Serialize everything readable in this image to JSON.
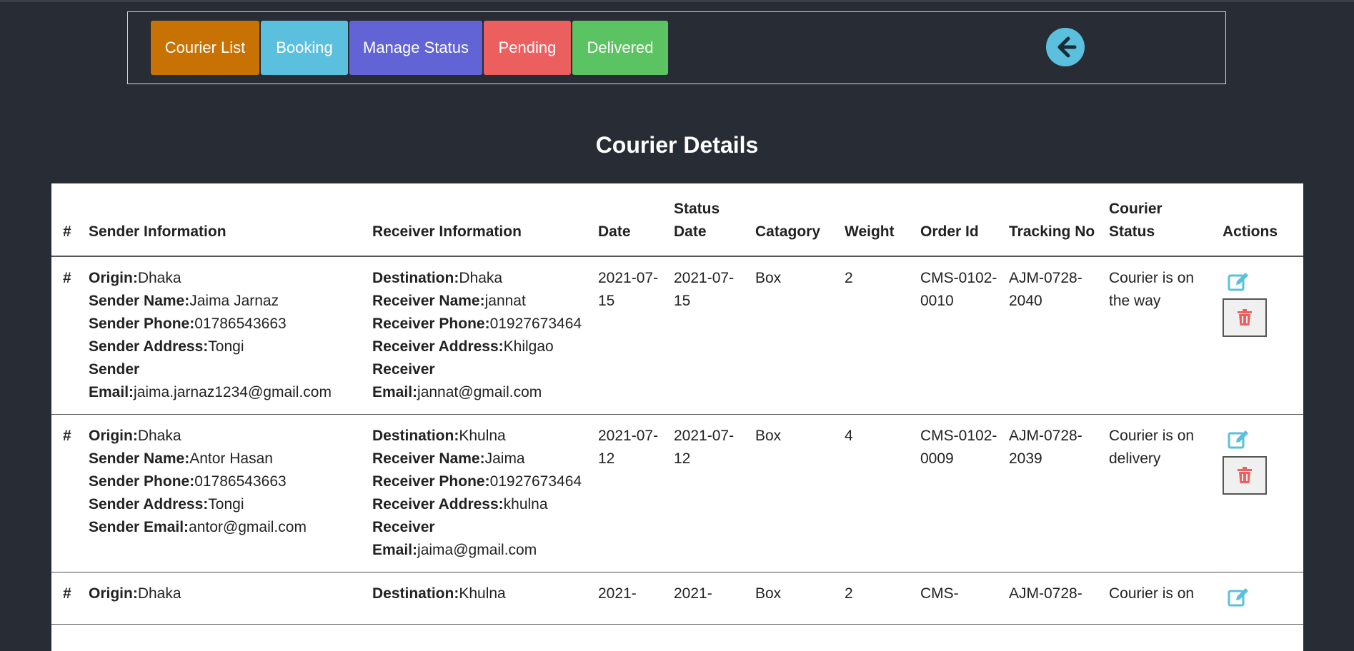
{
  "nav": {
    "buttons": [
      {
        "label": "Courier List",
        "color": "#c87203"
      },
      {
        "label": "Booking",
        "color": "#5bc0de"
      },
      {
        "label": "Manage Status",
        "color": "#6264d6"
      },
      {
        "label": "Pending",
        "color": "#ec5f5f"
      },
      {
        "label": "Delivered",
        "color": "#5cc362"
      }
    ],
    "back_icon": "arrow-left-circle-icon"
  },
  "title": "Courier Details",
  "table": {
    "headers": {
      "num": "#",
      "sender": "Sender Information",
      "receiver": "Receiver Information",
      "date": "Date",
      "status_date": "Status Date",
      "category": "Catagory",
      "weight": "Weight",
      "order_id": "Order Id",
      "tracking": "Tracking No",
      "courier_status": "Courier Status",
      "actions": "Actions"
    },
    "labels": {
      "origin": "Origin:",
      "sender_name": "Sender Name:",
      "sender_phone": "Sender Phone:",
      "sender_address": "Sender Address:",
      "sender_email": "Sender Email:",
      "destination": "Destination:",
      "receiver_name": "Receiver Name:",
      "receiver_phone": "Receiver Phone:",
      "receiver_address": "Receiver Address:",
      "receiver_email": "Receiver Email:"
    },
    "rows": [
      {
        "num": "#",
        "origin": "Dhaka",
        "sender_name": "Jaima Jarnaz",
        "sender_phone": "01786543663",
        "sender_address": "Tongi",
        "sender_email": "jaima.jarnaz1234@gmail.com",
        "destination": "Dhaka",
        "receiver_name": "jannat",
        "receiver_phone": "01927673464",
        "receiver_address": "Khilgao",
        "receiver_email": "jannat@gmail.com",
        "date": "2021-07-15",
        "status_date": "2021-07-15",
        "category": "Box",
        "weight": "2",
        "order_id": "CMS-0102-0010",
        "tracking": "AJM-0728-2040",
        "courier_status": "Courier is on the way"
      },
      {
        "num": "#",
        "origin": "Dhaka",
        "sender_name": "Antor Hasan",
        "sender_phone": "01786543663",
        "sender_address": "Tongi",
        "sender_email": "antor@gmail.com",
        "destination": "Khulna",
        "receiver_name": "Jaima",
        "receiver_phone": "01927673464",
        "receiver_address": "khulna",
        "receiver_email": "jaima@gmail.com",
        "date": "2021-07-12",
        "status_date": "2021-07-12",
        "category": "Box",
        "weight": "4",
        "order_id": "CMS-0102-0009",
        "tracking": "AJM-0728-2039",
        "courier_status": "Courier is on delivery"
      },
      {
        "num": "#",
        "origin": "Dhaka",
        "sender_name": "",
        "sender_phone": "",
        "sender_address": "",
        "sender_email": "",
        "destination": "Khulna",
        "receiver_name": "",
        "receiver_phone": "",
        "receiver_address": "",
        "receiver_email": "",
        "date": "2021-",
        "status_date": "2021-",
        "category": "Box",
        "weight": "2",
        "order_id": "CMS-",
        "tracking": "AJM-0728-",
        "courier_status": "Courier is on"
      }
    ],
    "edit_icon": "edit-icon",
    "delete_icon": "trash-icon"
  }
}
